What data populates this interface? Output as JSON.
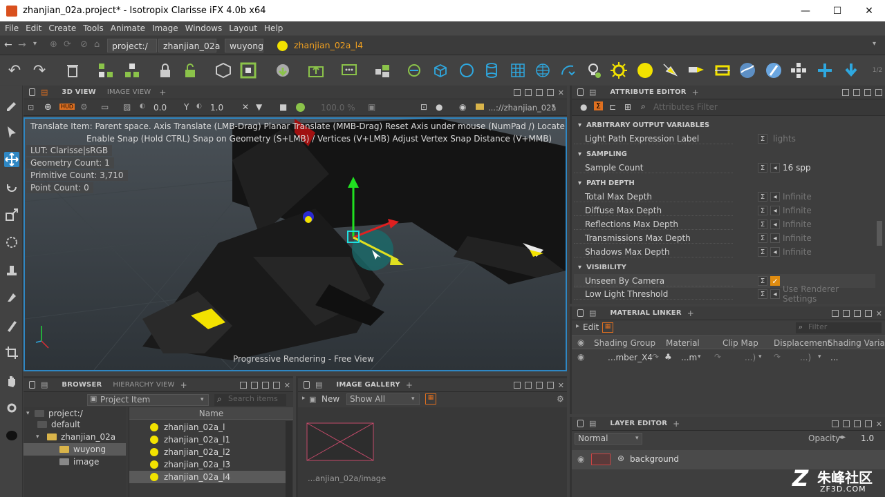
{
  "window": {
    "title": "zhanjian_02a.project* - Isotropix Clarisse iFX 4.0b x64",
    "minimize": "—",
    "maximize": "☐",
    "close": "✕"
  },
  "menu": [
    "File",
    "Edit",
    "Create",
    "Tools",
    "Animate",
    "Image",
    "Windows",
    "Layout",
    "Help"
  ],
  "path": {
    "segments": [
      "project:/",
      "zhanjian_02a",
      "wuyong"
    ],
    "current": "zhanjian_02a_l4"
  },
  "viewport_panel": {
    "tabs": [
      "3D VIEW",
      "IMAGE VIEW"
    ],
    "field_1": "0.0",
    "field_2": "1.0",
    "field_3": "100.0 %",
    "path": "...://zhanjian_02a"
  },
  "viewport": {
    "hint_1": "Translate Item: Parent space. Axis Translate (LMB-Drag)  Planar Translate (MMB-Drag) Reset Axis under mouse (NumPad /)  Locate Manipulator (M/",
    "hint_2": "Enable Snap (Hold CTRL) Snap on Geometry (S+LMB) / Vertices (V+LMB) Adjust Vertex Snap Distance (V+MMB)",
    "lut": "LUT: Clarisse|sRGB",
    "geometry_count": "Geometry Count: 1",
    "primitive_count": "Primitive Count: 3,710",
    "point_count": "Point Count: 0",
    "status": "Progressive Rendering - Free View"
  },
  "attribute_editor": {
    "tab": "ATTRIBUTE EDITOR",
    "filter_placeholder": "Attributes Filter",
    "sections": [
      {
        "title": "ARBITRARY OUTPUT VARIABLES",
        "rows": [
          {
            "label": "Light Path Expression Label",
            "value": "lights"
          }
        ]
      },
      {
        "title": "SAMPLING",
        "rows": [
          {
            "label": "Sample Count",
            "value": "16 spp"
          }
        ]
      },
      {
        "title": "PATH DEPTH",
        "rows": [
          {
            "label": "Total Max Depth",
            "value": "Infinite"
          },
          {
            "label": "Diffuse Max Depth",
            "value": "Infinite"
          },
          {
            "label": "Reflections Max Depth",
            "value": "Infinite"
          },
          {
            "label": "Transmissions Max Depth",
            "value": "Infinite"
          },
          {
            "label": "Shadows Max Depth",
            "value": "Infinite"
          }
        ]
      },
      {
        "title": "VISIBILITY",
        "rows": [
          {
            "label": "Unseen By Camera",
            "value": ""
          },
          {
            "label": "Low Light Threshold",
            "value": "Use Renderer Settings"
          }
        ]
      }
    ]
  },
  "material_linker": {
    "tab": "MATERIAL LINKER",
    "edit": "Edit",
    "filter_placeholder": "Filter",
    "columns": [
      "Shading Group",
      "Material",
      "Clip Map",
      "Displacement",
      "Shading Variable"
    ],
    "row": {
      "group": "...mber_X4",
      "material": "...m",
      "clip": "...)",
      "disp": "...)",
      "var": "..."
    }
  },
  "layer_editor": {
    "tab": "LAYER EDITOR",
    "blend": "Normal",
    "opacity_label": "Opacity",
    "opacity": "1.0",
    "layer": "background"
  },
  "browser": {
    "tabs": [
      "BROWSER",
      "HIERARCHY VIEW"
    ],
    "type": "Project Item",
    "search_placeholder": "Search items",
    "tree": [
      "project:/",
      "default",
      "zhanjian_02a",
      "wuyong",
      "image"
    ],
    "column": "Name",
    "items": [
      "zhanjian_02a_l",
      "zhanjian_02a_l1",
      "zhanjian_02a_l2",
      "zhanjian_02a_l3",
      "zhanjian_02a_l4"
    ]
  },
  "image_gallery": {
    "tab": "IMAGE GALLERY",
    "new": "New",
    "show": "Show All",
    "thumb_label": "...anjian_02a/image"
  },
  "watermark": {
    "brand": "朱峰社区",
    "site": "ZF3D.COM"
  },
  "colors": {
    "accent": "#2e87c4",
    "yellow": "#f2e200",
    "orange": "#e07020"
  }
}
